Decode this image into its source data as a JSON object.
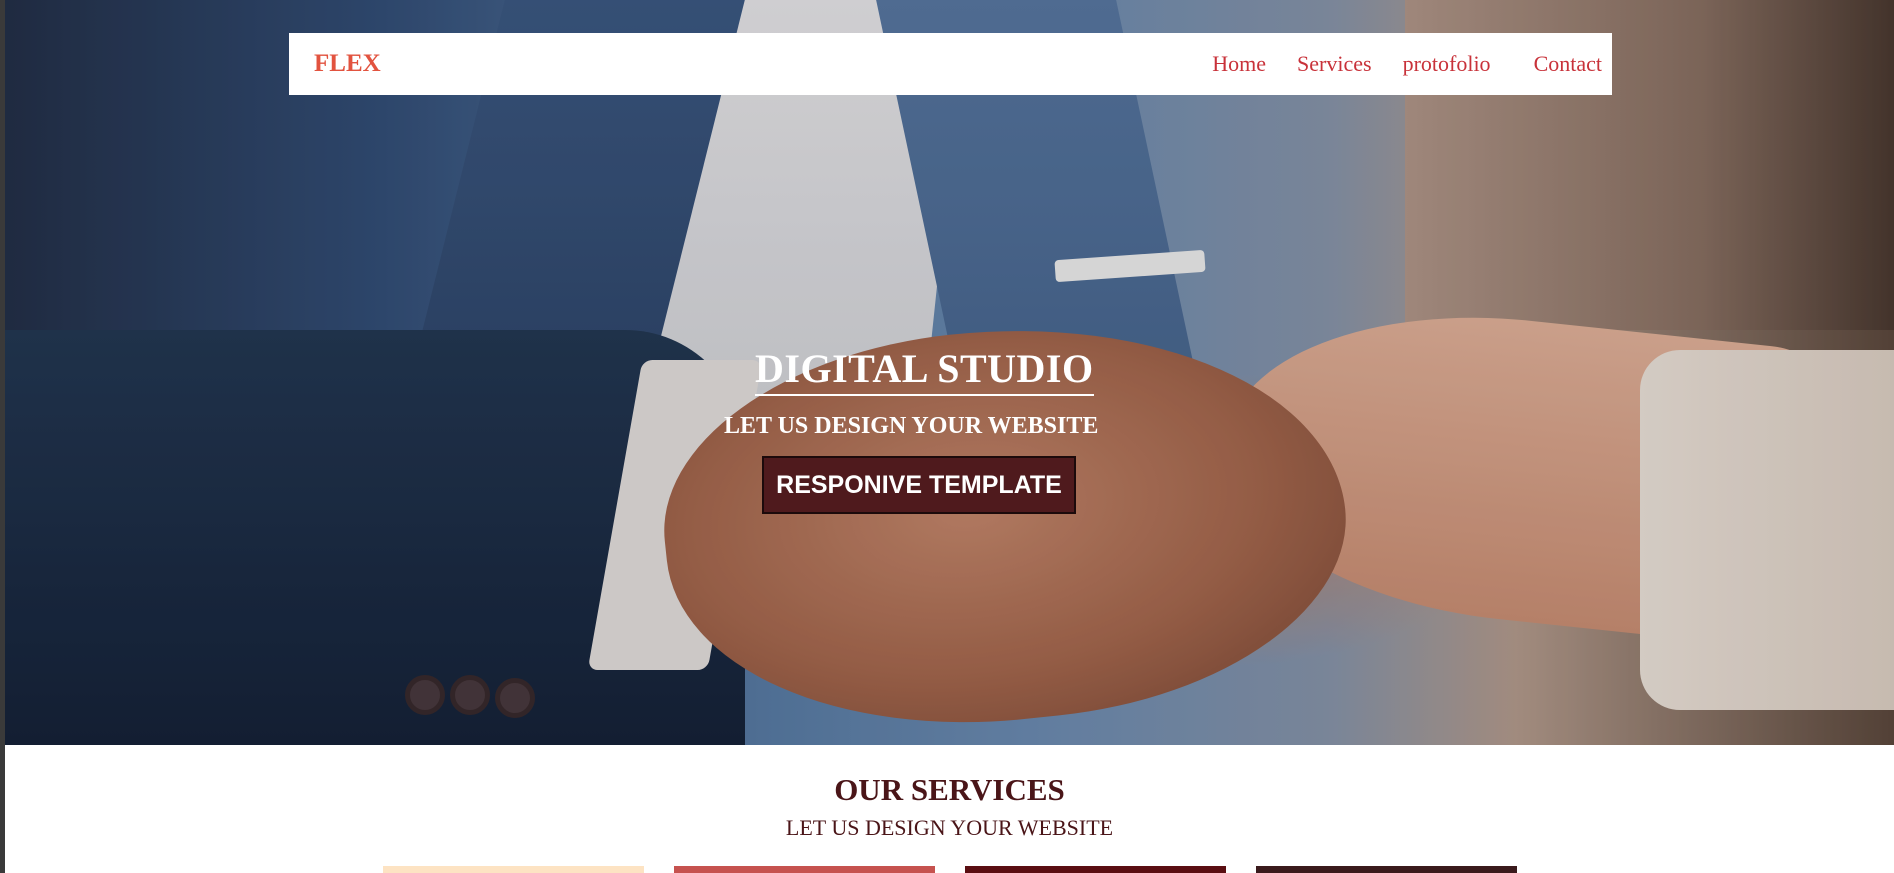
{
  "nav": {
    "logo": "FLEX",
    "links": [
      "Home",
      "Services",
      "protofolio",
      "Contact"
    ]
  },
  "hero": {
    "title": "DIGITAL STUDIO",
    "subtitle": "LET US DESIGN YOUR WEBSITE",
    "button_label": "RESPONIVE TEMPLATE",
    "image_description": "handshake-photo"
  },
  "services": {
    "title": "OUR SERVICES",
    "subtitle": "LET US DESIGN YOUR WEBSITE",
    "cards": [
      {
        "color": "#fde3c3"
      },
      {
        "color": "#c6524f"
      },
      {
        "color": "#5a0e12"
      },
      {
        "color": "#3a1a1c"
      }
    ]
  },
  "colors": {
    "accent": "#c8323a",
    "logo": "#e2533f",
    "button": "#4f1a1d",
    "heading": "#4a1518"
  }
}
